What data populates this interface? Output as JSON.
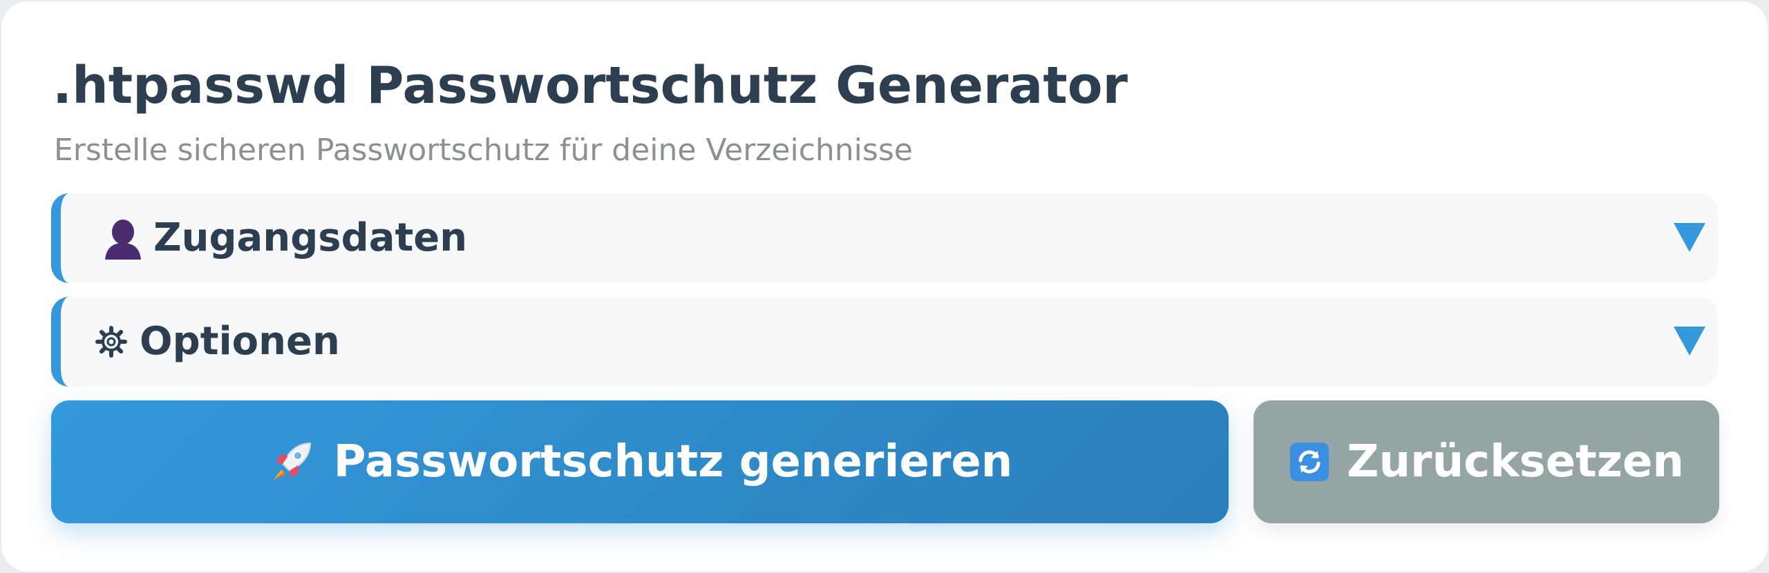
{
  "header": {
    "title": ".htpasswd Passwortschutz Generator",
    "subtitle": "Erstelle sicheren Passwortschutz für deine Verzeichnisse"
  },
  "sections": [
    {
      "label": "Zugangsdaten",
      "icon": "user-silhouette-icon",
      "expanded": false
    },
    {
      "label": "Optionen",
      "icon": "gear-icon",
      "expanded": false
    }
  ],
  "actions": {
    "generate_label": "Passwortschutz generieren",
    "generate_icon": "rocket-icon",
    "reset_label": "Zurücksetzen",
    "reset_icon": "refresh-icon"
  },
  "colors": {
    "accent": "#3498db",
    "title": "#2c3e50",
    "subtitle": "#8a9093",
    "section_bg": "#f6f8fa",
    "reset_button": "#95a5a6"
  }
}
